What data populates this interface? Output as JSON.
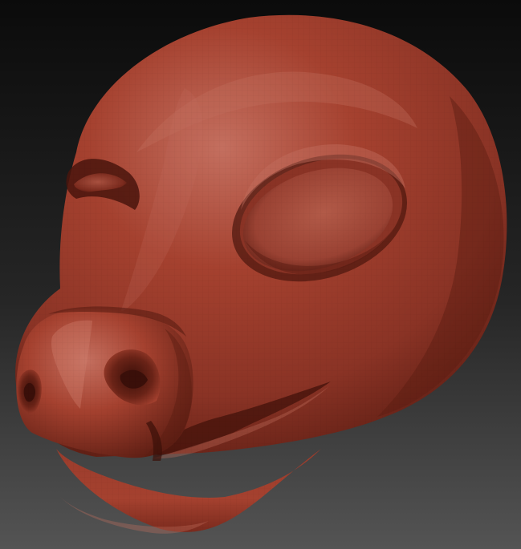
{
  "scene": {
    "subject": "sculpted-animal-head",
    "colors": {
      "background_top": "#0b0b0b",
      "background_mid": "#262626",
      "background_bottom": "#545454",
      "clay_highlight": "#c46f5f",
      "clay_base": "#a5412f",
      "clay_mid": "#8a3325",
      "clay_shadow": "#5a1c12",
      "clay_deep": "#3a0f09"
    }
  }
}
